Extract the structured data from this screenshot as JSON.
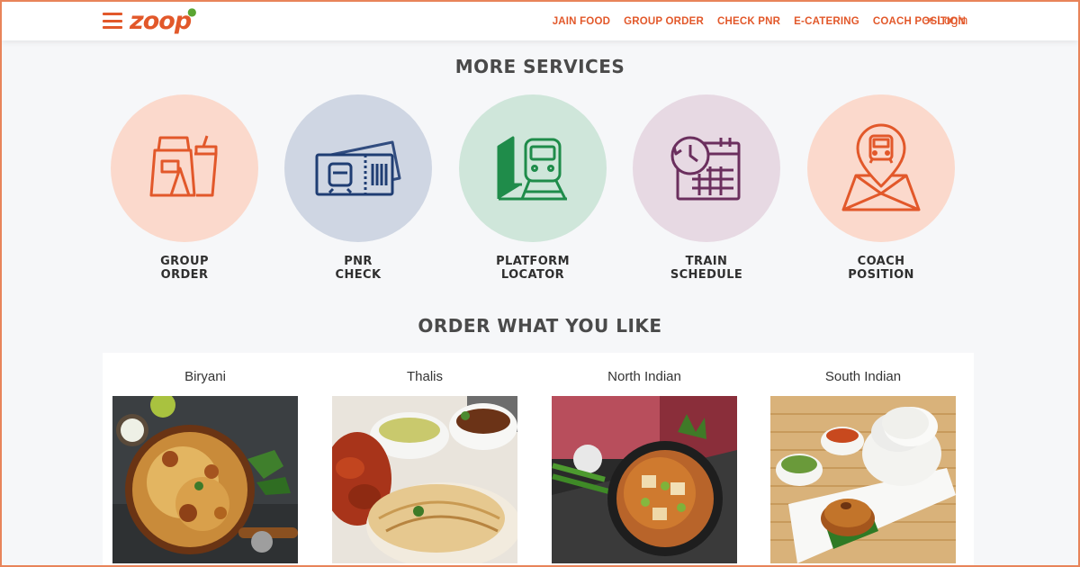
{
  "header": {
    "logo_text": "zoop",
    "nav": [
      "JAIN FOOD",
      "GROUP ORDER",
      "CHECK PNR",
      "E-CATERING",
      "COACH POSITION"
    ],
    "login_label": "Login"
  },
  "services": {
    "title": "MORE SERVICES",
    "items": [
      {
        "line1": "GROUP",
        "line2": "ORDER",
        "icon": "food-bag-icon",
        "bg": "#fbd9cc",
        "stroke": "#e2582a"
      },
      {
        "line1": "PNR",
        "line2": "CHECK",
        "icon": "train-ticket-icon",
        "bg": "#cfd6e3",
        "stroke": "#1f3d73"
      },
      {
        "line1": "PLATFORM",
        "line2": "LOCATOR",
        "icon": "platform-train-icon",
        "bg": "#cfe6da",
        "stroke": "#1f8c4a"
      },
      {
        "line1": "TRAIN",
        "line2": "SCHEDULE",
        "icon": "schedule-calendar-icon",
        "bg": "#e7d9e3",
        "stroke": "#6b2f5e"
      },
      {
        "line1": "COACH",
        "line2": "POSITION",
        "icon": "coach-map-pin-icon",
        "bg": "#fbd9cc",
        "stroke": "#e2582a"
      }
    ]
  },
  "categories": {
    "title": "ORDER WHAT YOU LIKE",
    "items": [
      {
        "name": "Biryani"
      },
      {
        "name": "Thalis"
      },
      {
        "name": "North Indian"
      },
      {
        "name": "South Indian"
      }
    ]
  },
  "colors": {
    "accent": "#e2582a",
    "background": "#f6f7f9"
  }
}
